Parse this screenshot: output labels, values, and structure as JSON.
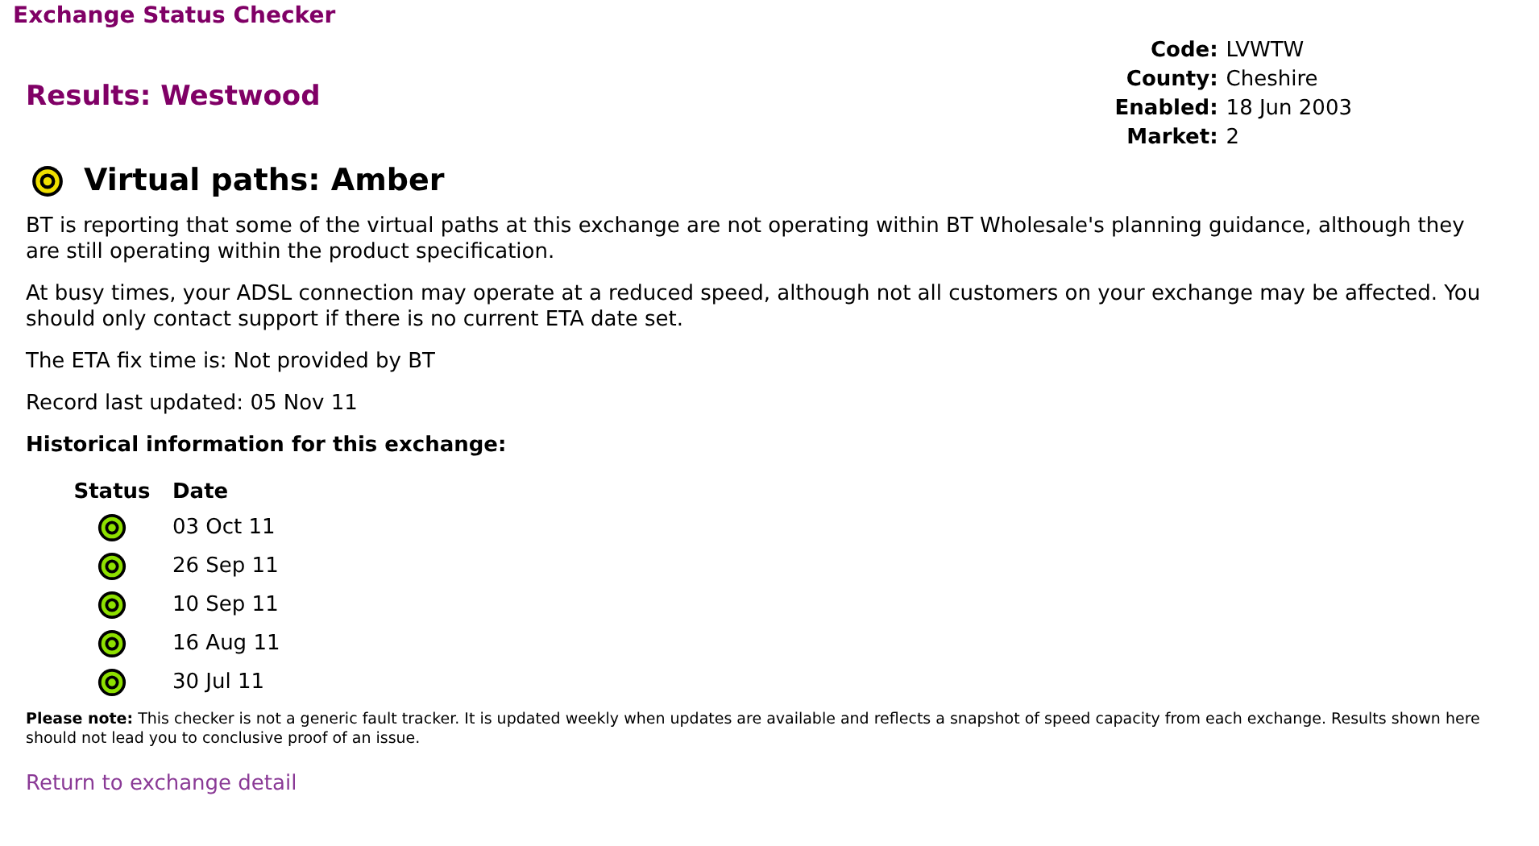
{
  "site_title": "Exchange Status Checker",
  "results_title": "Results: Westwood",
  "details": [
    {
      "label": "Code:",
      "value": "LVWTW"
    },
    {
      "label": "County:",
      "value": "Cheshire"
    },
    {
      "label": "Enabled:",
      "value": "18 Jun 2003"
    },
    {
      "label": "Market:",
      "value": "2"
    }
  ],
  "status": {
    "color": "#f0e000",
    "heading": "Virtual paths: Amber"
  },
  "paragraphs": [
    "BT is reporting that some of the virtual paths at this exchange are not operating within BT Wholesale's planning guidance, although they are still operating within the product specification.",
    "At busy times, your ADSL connection may operate at a reduced speed, although not all customers on your exchange may be affected. You should only contact support if there is no current ETA date set.",
    "The ETA fix time is: Not provided by BT",
    "Record last updated: 05 Nov 11"
  ],
  "history": {
    "heading": "Historical information for this exchange:",
    "columns": [
      "Status",
      "Date"
    ],
    "rows": [
      {
        "color": "#8ee000",
        "date": "03 Oct 11"
      },
      {
        "color": "#8ee000",
        "date": "26 Sep 11"
      },
      {
        "color": "#8ee000",
        "date": "10 Sep 11"
      },
      {
        "color": "#8ee000",
        "date": "16 Aug 11"
      },
      {
        "color": "#8ee000",
        "date": "30 Jul 11"
      }
    ]
  },
  "note": "**Please note:** This checker is not a generic fault tracker. It is updated weekly when updates are available and reflects a snapshot of speed capacity from each exchange. Results shown here should not lead you to conclusive proof of an issue.",
  "return_link": "Return to exchange detail"
}
